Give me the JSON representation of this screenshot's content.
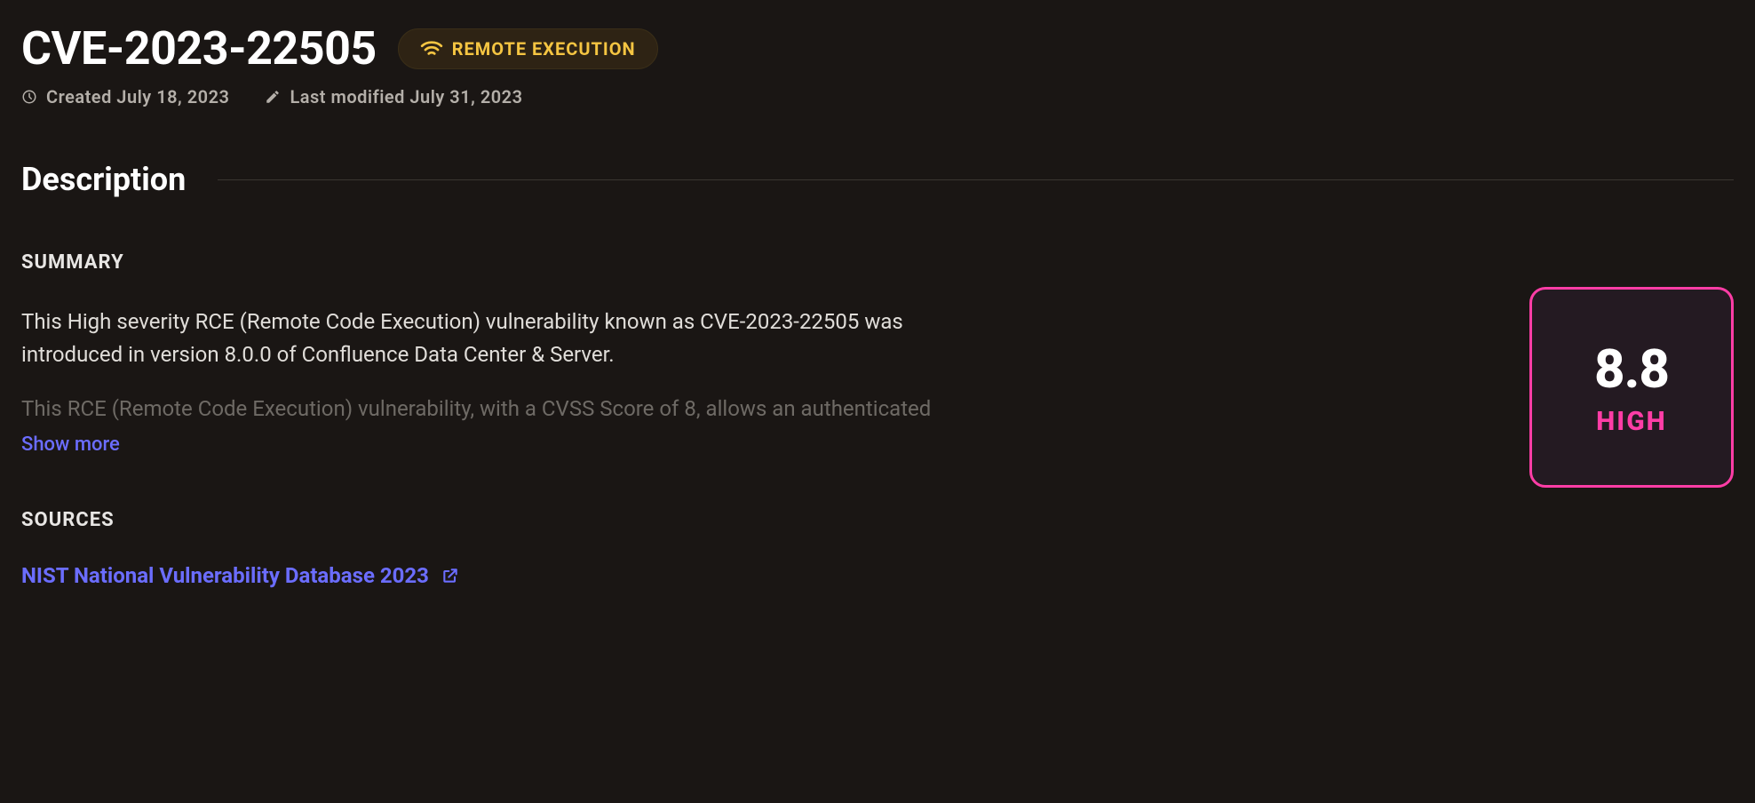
{
  "header": {
    "cve_id": "CVE-2023-22505",
    "badge_label": "REMOTE EXECUTION"
  },
  "meta": {
    "created_label": "Created July 18, 2023",
    "modified_label": "Last modified July 31, 2023"
  },
  "section": {
    "description_title": "Description"
  },
  "summary": {
    "heading": "SUMMARY",
    "paragraph1": "This High severity RCE (Remote Code Execution) vulnerability known as CVE-2023-22505 was introduced in version 8.0.0 of Confluence Data Center & Server.",
    "paragraph2": "This RCE (Remote Code Execution) vulnerability, with a CVSS Score of 8, allows an authenticated",
    "show_more": "Show more"
  },
  "score": {
    "value": "8.8",
    "label": "HIGH"
  },
  "sources": {
    "heading": "SOURCES",
    "link_label": "NIST National Vulnerability Database 2023"
  }
}
